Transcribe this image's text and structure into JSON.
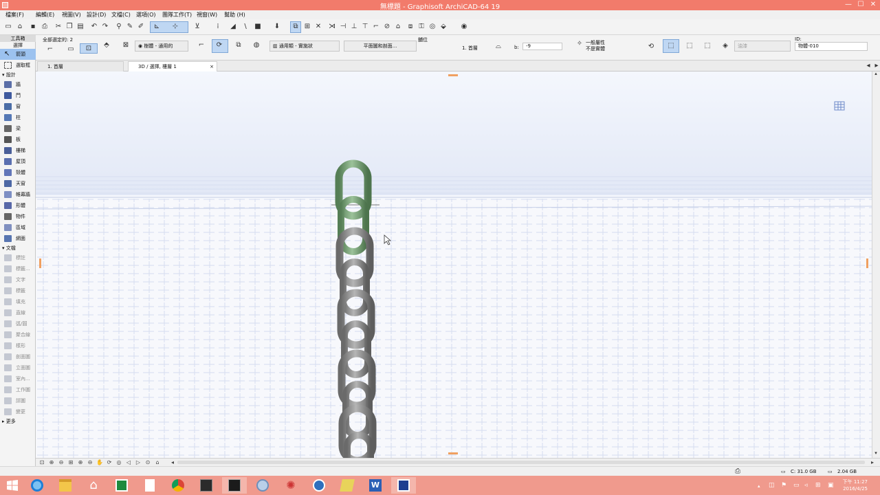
{
  "window": {
    "title": "無標題 - Graphisoft ArchiCAD-64 19",
    "minimize": "—",
    "maximize": "☐",
    "close": "✕"
  },
  "menu": [
    "檔案(F)",
    "編輯(E)",
    "視圖(V)",
    "設計(D)",
    "文檔(C)",
    "選項(O)",
    "團隊工作(T)",
    "視窗(W)",
    "幫助 (H)"
  ],
  "infobox": {
    "selected_count": "全部選定的: 2",
    "layer_dropdown": "樹體 - 通用的",
    "tool_label": "通用類 - 實施狀",
    "plan_button": "平面圖和剖面...",
    "position_label": "舖位",
    "story_label": "1. 首層",
    "elevation_label": "b:",
    "elevation_value": "-9",
    "info_line1": "一般屬性",
    "info_line2": "不是實體",
    "render_label": "油漆",
    "id_label": "ID:",
    "id_value": "物體-010"
  },
  "toolbox": {
    "title": "工具箱",
    "select_header": "選擇",
    "arrow_label": "箭頭",
    "marquee_label": "選取框",
    "design_header": "設計",
    "design_tools": [
      "牆",
      "門",
      "窗",
      "柱",
      "梁",
      "板",
      "樓梯",
      "屋頂",
      "殼體",
      "天窗",
      "帷幕牆",
      "形體",
      "物件",
      "區域",
      "網面"
    ],
    "document_header": "文檔",
    "document_tools": [
      "標註",
      "標籤...",
      "文字",
      "標籤",
      "填充",
      "直線",
      "弧/圓",
      "聚合線",
      "樣形",
      "剖面圖",
      "立面圖",
      "室內...",
      "工作圖",
      "詳圖",
      "變更"
    ],
    "more_label": "更多"
  },
  "tabs": [
    {
      "label": "1. 首層",
      "active": false
    },
    {
      "label": "3D / 選擇, 樓層 1",
      "active": true,
      "close": "×"
    }
  ],
  "statusbar": {
    "disk_free": "C: 31.0 GB",
    "memory": "2.04 GB"
  },
  "taskbar": {
    "time": "下午 11:27",
    "date": "2016/4/25",
    "apps": [
      "start",
      "ie",
      "explorer",
      "home",
      "excel",
      "file",
      "chrome",
      "archicad-a",
      "archicad-b",
      "paint",
      "media",
      "network",
      "folder",
      "word",
      "archicad-c"
    ]
  },
  "colors": {
    "titlebar": "#f27b6b",
    "taskbar": "#f09a8d",
    "chain_selected": "#7da27b",
    "chain": "#8d8d8d",
    "grid": "#c8d2e8"
  }
}
